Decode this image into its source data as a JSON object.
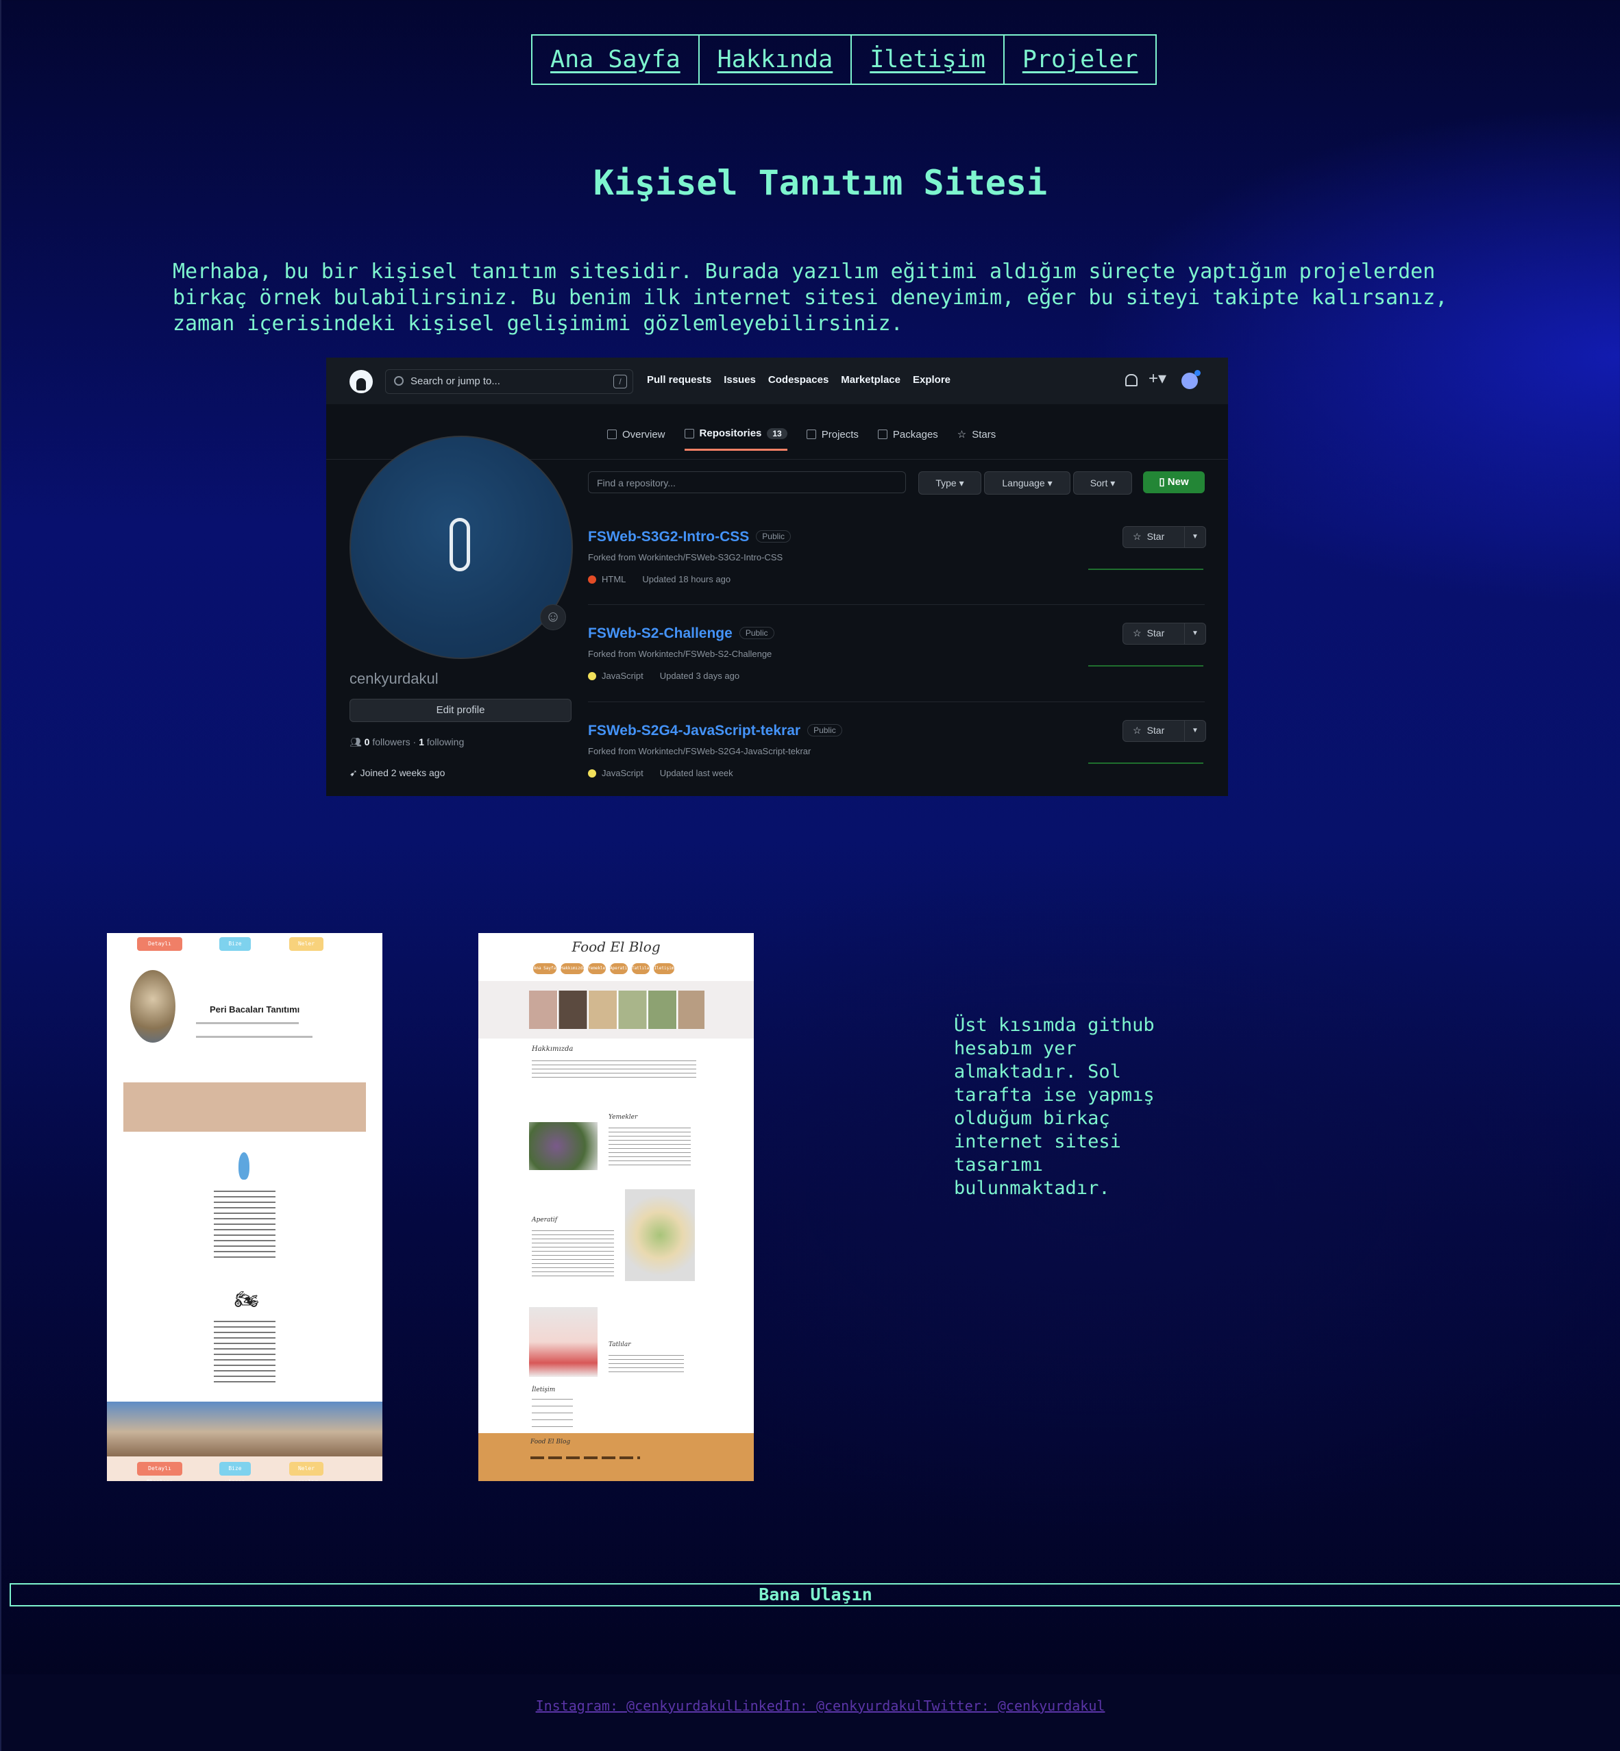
{
  "nav": {
    "items": [
      "Ana Sayfa",
      "Hakkında",
      "İletişim",
      "Projeler"
    ]
  },
  "hero": {
    "title": "Kişisel Tanıtım Sitesi",
    "intro": "Merhaba, bu bir kişisel tanıtım sitesidir. Burada yazılım eğitimi aldığım süreçte yaptığım projelerden birkaç örnek bulabilirsiniz. Bu benim ilk internet sitesi deneyimim, eğer bu siteyi takipte kalırsanız, zaman içerisindeki kişisel gelişimimi gözlemleyebilirsiniz."
  },
  "github": {
    "search_placeholder": "Search or jump to...",
    "search_key": "/",
    "topnav": [
      "Pull requests",
      "Issues",
      "Codespaces",
      "Marketplace",
      "Explore"
    ],
    "tabs": [
      "Overview",
      "Repositories",
      "Projects",
      "Packages",
      "Stars"
    ],
    "repo_count": "13",
    "username": "cenkyurdakul",
    "edit_profile": "Edit profile",
    "followers": "0",
    "followers_label": "followers",
    "following": "1",
    "following_label": "following",
    "joined": "Joined 2 weeks ago",
    "find_placeholder": "Find a repository...",
    "filters": [
      "Type",
      "Language",
      "Sort"
    ],
    "new_label": "New",
    "star_label": "Star",
    "public_label": "Public",
    "repos": [
      {
        "name": "FSWeb-S3G2-Intro-CSS",
        "fork": "Forked from Workintech/FSWeb-S3G2-Intro-CSS",
        "lang": "HTML",
        "lang_color": "#e34c26",
        "updated": "Updated 18 hours ago"
      },
      {
        "name": "FSWeb-S2-Challenge",
        "fork": "Forked from Workintech/FSWeb-S2-Challenge",
        "lang": "JavaScript",
        "lang_color": "#f1e05a",
        "updated": "Updated 3 days ago"
      },
      {
        "name": "FSWeb-S2G4-JavaScript-tekrar",
        "fork": "Forked from Workintech/FSWeb-S2G4-JavaScript-tekrar",
        "lang": "JavaScript",
        "lang_color": "#f1e05a",
        "updated": "Updated last week"
      }
    ]
  },
  "project1": {
    "title": "Peri Bacaları Tanıtımı",
    "pills": [
      "Detaylı Planlama",
      "Bize ulaşın",
      "Neler yapılır"
    ]
  },
  "project2": {
    "title": "Food El Blog",
    "pills": [
      "Ana Sayfa",
      "Hakkımızda",
      "Yemekler",
      "Aperatif",
      "Tatlılar",
      "İletişim"
    ],
    "sections": [
      "Hakkımızda",
      "Yemekler",
      "Aperatif",
      "Tatlılar",
      "İletişim"
    ],
    "footer_title": "Food El Blog"
  },
  "side_text": "Üst kısımda github hesabım yer almaktadır. Sol tarafta ise yapmış olduğum birkaç internet sitesi tasarımı bulunmaktadır.",
  "contact": {
    "title": "Bana Ulaşın"
  },
  "footer": {
    "links": [
      "Instagram: @cenkyurdakul",
      "LinkedIn: @cenkyurdakul",
      "Twitter: @cenkyurdakul"
    ]
  },
  "colors": {
    "accent": "#7ef5cf",
    "footer_link": "#5b35a8",
    "github_bg": "#0d1117",
    "github_link": "#4493f8",
    "new_button": "#238636"
  }
}
